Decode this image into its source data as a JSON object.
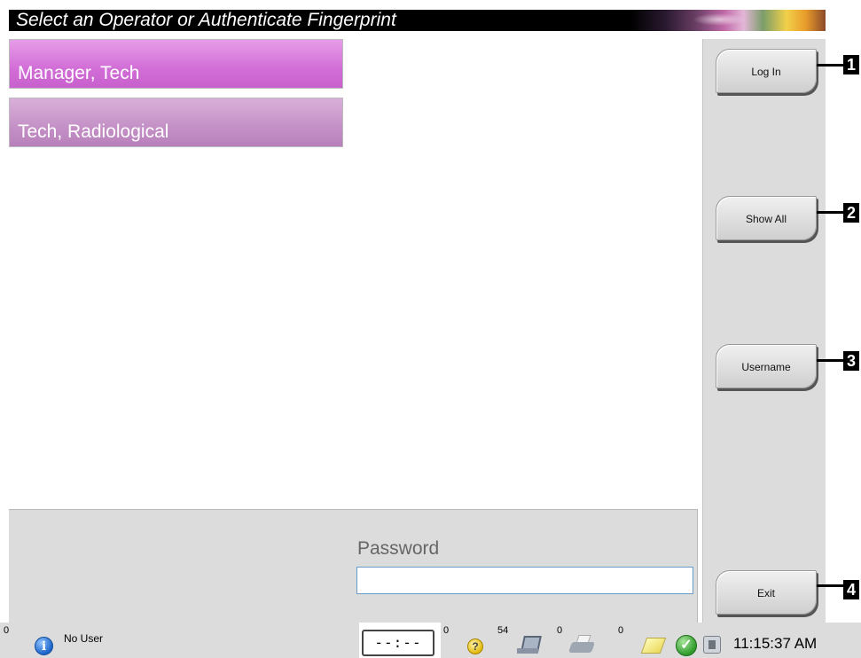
{
  "header": {
    "title": "Select an Operator or Authenticate Fingerprint"
  },
  "operators": [
    {
      "label": "Manager, Tech",
      "color": "#d26ed7"
    },
    {
      "label": "Tech, Radiological",
      "color": "#c490c6"
    }
  ],
  "sidebar": {
    "login_label": "Log In",
    "show_all_label": "Show All",
    "username_label": "Username",
    "exit_label": "Exit"
  },
  "callouts": [
    "1",
    "2",
    "3",
    "4"
  ],
  "password": {
    "label": "Password",
    "value": ""
  },
  "statusbar": {
    "alerts_count": "0",
    "user": "No User",
    "timer": "--:--",
    "help_count": "0",
    "film_count": "54",
    "printer_count": "0",
    "notes_count": "0",
    "time": "11:15:37 AM"
  },
  "icons": [
    "info-icon",
    "help-icon",
    "film-icon",
    "printer-icon",
    "note-icon",
    "check-icon",
    "connection-icon"
  ]
}
